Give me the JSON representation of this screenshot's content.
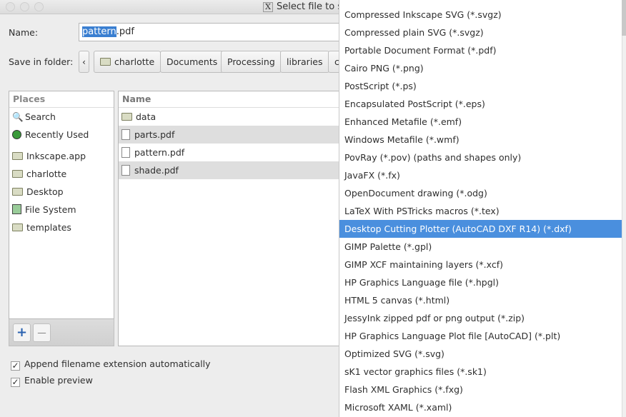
{
  "window": {
    "title": "Select file to s"
  },
  "name_field": {
    "label": "Name:",
    "value_selected": "pattern",
    "value_rest": ".pdf"
  },
  "folder": {
    "label": "Save in folder:",
    "crumbs": [
      "charlotte",
      "Documents",
      "Processing",
      "libraries",
      "c"
    ]
  },
  "places": {
    "header": "Places",
    "items": [
      {
        "label": "Search",
        "icon": "search-icon"
      },
      {
        "label": "Recently Used",
        "icon": "recent-icon"
      },
      {
        "label": "Inkscape.app",
        "icon": "folder-icon"
      },
      {
        "label": "charlotte",
        "icon": "folder-icon"
      },
      {
        "label": "Desktop",
        "icon": "folder-icon"
      },
      {
        "label": "File System",
        "icon": "drive-icon"
      },
      {
        "label": "templates",
        "icon": "folder-icon"
      }
    ]
  },
  "files": {
    "header": "Name",
    "items": [
      {
        "name": "data",
        "type": "folder"
      },
      {
        "name": "parts.pdf",
        "type": "file"
      },
      {
        "name": "pattern.pdf",
        "type": "file"
      },
      {
        "name": "shade.pdf",
        "type": "file"
      }
    ]
  },
  "options": {
    "append_ext": {
      "label": "Append filename extension automatically",
      "checked": true
    },
    "preview": {
      "label": "Enable preview",
      "checked": true
    }
  },
  "format_menu": {
    "selected_index": 12,
    "items": [
      "Compressed Inkscape SVG (*.svgz)",
      "Compressed plain SVG (*.svgz)",
      "Portable Document Format (*.pdf)",
      "Cairo PNG (*.png)",
      "PostScript (*.ps)",
      "Encapsulated PostScript (*.eps)",
      "Enhanced Metafile (*.emf)",
      "Windows Metafile (*.wmf)",
      "PovRay (*.pov) (paths and shapes only)",
      "JavaFX (*.fx)",
      "OpenDocument drawing (*.odg)",
      "LaTeX With PSTricks macros (*.tex)",
      "Desktop Cutting Plotter (AutoCAD DXF R14) (*.dxf)",
      "GIMP Palette (*.gpl)",
      "GIMP XCF maintaining layers (*.xcf)",
      "HP Graphics Language file (*.hpgl)",
      "HTML 5 canvas (*.html)",
      "JessyInk zipped pdf or png output (*.zip)",
      "HP Graphics Language Plot file [AutoCAD] (*.plt)",
      "Optimized SVG (*.svg)",
      "sK1 vector graphics files (*.sk1)",
      "Flash XML Graphics (*.fxg)",
      "Microsoft XAML (*.xaml)"
    ]
  },
  "colors": {
    "selection": "#4a8fde"
  }
}
